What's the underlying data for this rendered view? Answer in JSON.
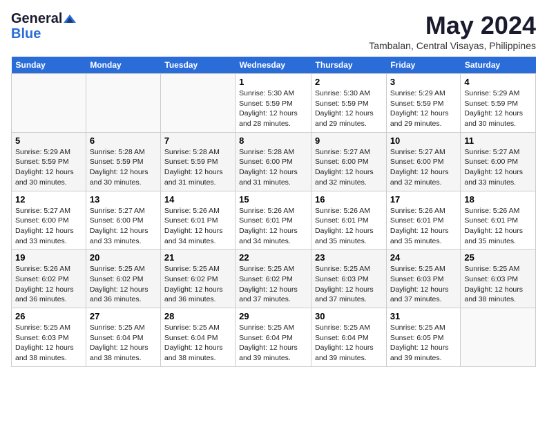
{
  "header": {
    "logo_line1": "General",
    "logo_line2": "Blue",
    "title": "May 2024",
    "location": "Tambalan, Central Visayas, Philippines"
  },
  "columns": [
    "Sunday",
    "Monday",
    "Tuesday",
    "Wednesday",
    "Thursday",
    "Friday",
    "Saturday"
  ],
  "weeks": [
    [
      {
        "num": "",
        "info": ""
      },
      {
        "num": "",
        "info": ""
      },
      {
        "num": "",
        "info": ""
      },
      {
        "num": "1",
        "info": "Sunrise: 5:30 AM\nSunset: 5:59 PM\nDaylight: 12 hours and 28 minutes."
      },
      {
        "num": "2",
        "info": "Sunrise: 5:30 AM\nSunset: 5:59 PM\nDaylight: 12 hours and 29 minutes."
      },
      {
        "num": "3",
        "info": "Sunrise: 5:29 AM\nSunset: 5:59 PM\nDaylight: 12 hours and 29 minutes."
      },
      {
        "num": "4",
        "info": "Sunrise: 5:29 AM\nSunset: 5:59 PM\nDaylight: 12 hours and 30 minutes."
      }
    ],
    [
      {
        "num": "5",
        "info": "Sunrise: 5:29 AM\nSunset: 5:59 PM\nDaylight: 12 hours and 30 minutes."
      },
      {
        "num": "6",
        "info": "Sunrise: 5:28 AM\nSunset: 5:59 PM\nDaylight: 12 hours and 30 minutes."
      },
      {
        "num": "7",
        "info": "Sunrise: 5:28 AM\nSunset: 5:59 PM\nDaylight: 12 hours and 31 minutes."
      },
      {
        "num": "8",
        "info": "Sunrise: 5:28 AM\nSunset: 6:00 PM\nDaylight: 12 hours and 31 minutes."
      },
      {
        "num": "9",
        "info": "Sunrise: 5:27 AM\nSunset: 6:00 PM\nDaylight: 12 hours and 32 minutes."
      },
      {
        "num": "10",
        "info": "Sunrise: 5:27 AM\nSunset: 6:00 PM\nDaylight: 12 hours and 32 minutes."
      },
      {
        "num": "11",
        "info": "Sunrise: 5:27 AM\nSunset: 6:00 PM\nDaylight: 12 hours and 33 minutes."
      }
    ],
    [
      {
        "num": "12",
        "info": "Sunrise: 5:27 AM\nSunset: 6:00 PM\nDaylight: 12 hours and 33 minutes."
      },
      {
        "num": "13",
        "info": "Sunrise: 5:27 AM\nSunset: 6:00 PM\nDaylight: 12 hours and 33 minutes."
      },
      {
        "num": "14",
        "info": "Sunrise: 5:26 AM\nSunset: 6:01 PM\nDaylight: 12 hours and 34 minutes."
      },
      {
        "num": "15",
        "info": "Sunrise: 5:26 AM\nSunset: 6:01 PM\nDaylight: 12 hours and 34 minutes."
      },
      {
        "num": "16",
        "info": "Sunrise: 5:26 AM\nSunset: 6:01 PM\nDaylight: 12 hours and 35 minutes."
      },
      {
        "num": "17",
        "info": "Sunrise: 5:26 AM\nSunset: 6:01 PM\nDaylight: 12 hours and 35 minutes."
      },
      {
        "num": "18",
        "info": "Sunrise: 5:26 AM\nSunset: 6:01 PM\nDaylight: 12 hours and 35 minutes."
      }
    ],
    [
      {
        "num": "19",
        "info": "Sunrise: 5:26 AM\nSunset: 6:02 PM\nDaylight: 12 hours and 36 minutes."
      },
      {
        "num": "20",
        "info": "Sunrise: 5:25 AM\nSunset: 6:02 PM\nDaylight: 12 hours and 36 minutes."
      },
      {
        "num": "21",
        "info": "Sunrise: 5:25 AM\nSunset: 6:02 PM\nDaylight: 12 hours and 36 minutes."
      },
      {
        "num": "22",
        "info": "Sunrise: 5:25 AM\nSunset: 6:02 PM\nDaylight: 12 hours and 37 minutes."
      },
      {
        "num": "23",
        "info": "Sunrise: 5:25 AM\nSunset: 6:03 PM\nDaylight: 12 hours and 37 minutes."
      },
      {
        "num": "24",
        "info": "Sunrise: 5:25 AM\nSunset: 6:03 PM\nDaylight: 12 hours and 37 minutes."
      },
      {
        "num": "25",
        "info": "Sunrise: 5:25 AM\nSunset: 6:03 PM\nDaylight: 12 hours and 38 minutes."
      }
    ],
    [
      {
        "num": "26",
        "info": "Sunrise: 5:25 AM\nSunset: 6:03 PM\nDaylight: 12 hours and 38 minutes."
      },
      {
        "num": "27",
        "info": "Sunrise: 5:25 AM\nSunset: 6:04 PM\nDaylight: 12 hours and 38 minutes."
      },
      {
        "num": "28",
        "info": "Sunrise: 5:25 AM\nSunset: 6:04 PM\nDaylight: 12 hours and 38 minutes."
      },
      {
        "num": "29",
        "info": "Sunrise: 5:25 AM\nSunset: 6:04 PM\nDaylight: 12 hours and 39 minutes."
      },
      {
        "num": "30",
        "info": "Sunrise: 5:25 AM\nSunset: 6:04 PM\nDaylight: 12 hours and 39 minutes."
      },
      {
        "num": "31",
        "info": "Sunrise: 5:25 AM\nSunset: 6:05 PM\nDaylight: 12 hours and 39 minutes."
      },
      {
        "num": "",
        "info": ""
      }
    ]
  ]
}
